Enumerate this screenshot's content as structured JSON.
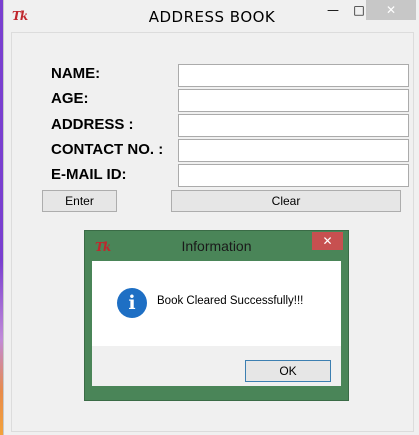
{
  "window": {
    "logo": "Tk",
    "title": "ADDRESS  BOOK",
    "minimize_icon": "minimize-icon",
    "maximize_icon": "maximize-icon",
    "close_icon": "close-icon"
  },
  "form": {
    "fields": [
      {
        "label": "NAME:",
        "value": ""
      },
      {
        "label": "AGE:",
        "value": ""
      },
      {
        "label": "ADDRESS :",
        "value": ""
      },
      {
        "label": "CONTACT NO. :",
        "value": ""
      },
      {
        "label": "E-MAIL ID:",
        "value": ""
      }
    ],
    "enter_label": "Enter",
    "clear_label": "Clear"
  },
  "dialog": {
    "logo": "Tk",
    "title": "Information",
    "message": "Book Cleared Successfully!!!",
    "ok_label": "OK",
    "icon": "info-icon",
    "frame_color": "#4a8558",
    "close_color": "#c75050"
  }
}
